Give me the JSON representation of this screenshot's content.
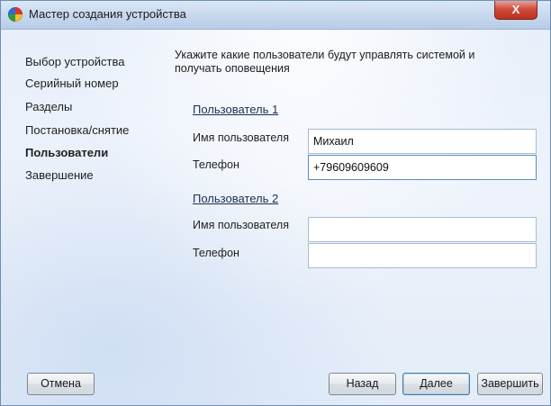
{
  "window": {
    "title": "Мастер создания устройства",
    "close_label": "X"
  },
  "sidebar": {
    "items": [
      {
        "label": "Выбор устройства",
        "active": false
      },
      {
        "label": "Серийный номер",
        "active": false
      },
      {
        "label": "Разделы",
        "active": false
      },
      {
        "label": "Постановка/снятие",
        "active": false
      },
      {
        "label": "Пользователи",
        "active": true
      },
      {
        "label": "Завершение",
        "active": false
      }
    ]
  },
  "main": {
    "instruction": "Укажите какие пользователи будут управлять системой и получать оповещения",
    "users": [
      {
        "section_label": "Пользователь 1",
        "name_label": "Имя пользователя",
        "name_value": "Михаил",
        "phone_label": "Телефон",
        "phone_value": "+79609609609"
      },
      {
        "section_label": "Пользователь 2",
        "name_label": "Имя пользователя",
        "name_value": "",
        "phone_label": "Телефон",
        "phone_value": ""
      }
    ]
  },
  "footer": {
    "cancel_label": "Отмена",
    "back_label": "Назад",
    "next_label": "Далее",
    "finish_label": "Завершить"
  },
  "colors": {
    "titlebar": "#c9daf0",
    "close_button": "#d24d3b",
    "window_background": "#e6eefa"
  }
}
